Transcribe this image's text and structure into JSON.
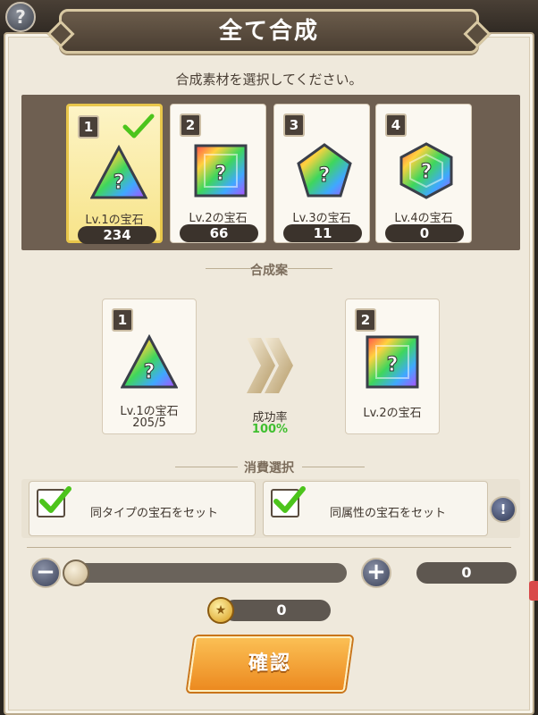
{
  "header": {
    "title": "全て合成",
    "help_icon": "?"
  },
  "instruction": "合成素材を選択してください。",
  "materials": [
    {
      "index": "1",
      "label": "Lv.1の宝石",
      "count": "234",
      "selected": true,
      "shape": "triangle"
    },
    {
      "index": "2",
      "label": "Lv.2の宝石",
      "count": "66",
      "selected": false,
      "shape": "square"
    },
    {
      "index": "3",
      "label": "Lv.3の宝石",
      "count": "11",
      "selected": false,
      "shape": "pentagon"
    },
    {
      "index": "4",
      "label": "Lv.4の宝石",
      "count": "0",
      "selected": false,
      "shape": "hexagon"
    }
  ],
  "plan": {
    "section_title": "合成案",
    "source": {
      "index": "1",
      "label": "Lv.1の宝石",
      "ratio": "205/5"
    },
    "result": {
      "index": "2",
      "label": "Lv.2の宝石"
    },
    "success_label": "成功率",
    "success_rate": "100%"
  },
  "consumption": {
    "section_title": "消費選択",
    "same_type_label": "同タイプの宝石をセット",
    "same_type_checked": true,
    "same_attr_label": "同属性の宝石をセット",
    "same_attr_checked": true,
    "info_icon": "!"
  },
  "quantity": {
    "value": "0",
    "minus": "−",
    "plus": "+",
    "slider_fraction": 0
  },
  "cost": {
    "value": "0"
  },
  "confirm_label": "確認",
  "colors": {
    "accent": "#f0a030",
    "success": "#3fbf2f",
    "check": "#4cc41c"
  }
}
